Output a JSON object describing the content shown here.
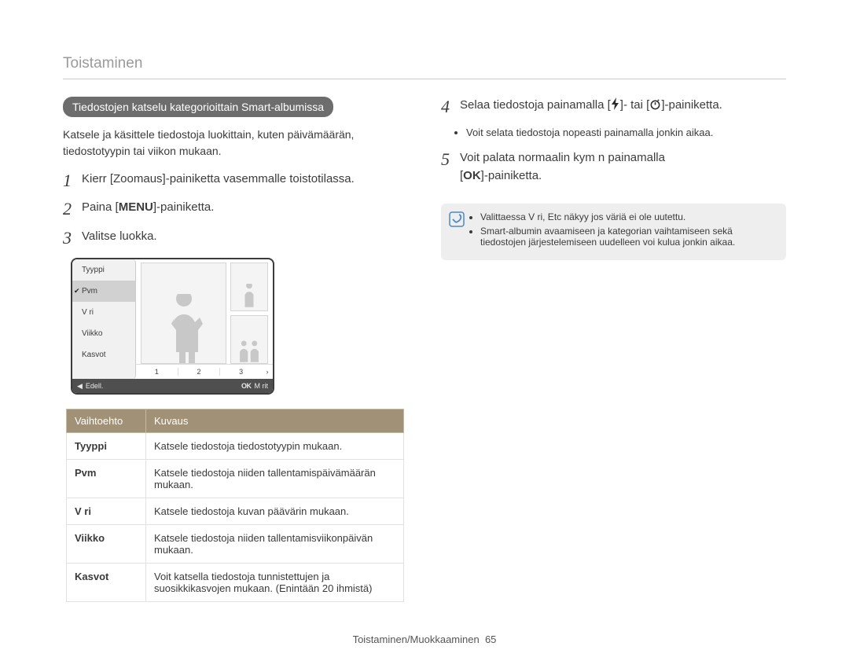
{
  "header": {
    "title": "Toistaminen"
  },
  "left": {
    "section_pill": "Tiedostojen katselu kategorioittain Smart-albumissa",
    "intro": "Katsele ja käsittele tiedostoja luokittain, kuten päivämäärän, tiedostotyypin tai viikon mukaan.",
    "steps": [
      {
        "num": "1",
        "prefix": "Kierr  [Zoomaus]-painiketta vasemmalle toistotilassa."
      },
      {
        "num": "2",
        "text_before": "Paina [",
        "label": "MENU",
        "text_after": "]-painiketta."
      },
      {
        "num": "3",
        "text": "Valitse luokka."
      }
    ],
    "camera": {
      "menu_items": [
        "Tyyppi",
        "Pvm",
        "V ri",
        "Viikko",
        "Kasvot"
      ],
      "selected_index": 1,
      "timeline": [
        "1",
        "2",
        "3"
      ],
      "footer_left_arrow": "◀",
      "footer_left_label": "Edell.",
      "footer_right_ok": "OK",
      "footer_right_label": "M rit"
    },
    "table": {
      "headers": [
        "Vaihtoehto",
        "Kuvaus"
      ],
      "rows": [
        [
          "Tyyppi",
          "Katsele tiedostoja tiedostotyypin mukaan."
        ],
        [
          "Pvm",
          "Katsele tiedostoja niiden tallentamispäivämäärän mukaan."
        ],
        [
          "V ri",
          "Katsele tiedostoja kuvan päävärin mukaan."
        ],
        [
          "Viikko",
          "Katsele tiedostoja niiden tallentamisviikonpäivän mukaan."
        ],
        [
          "Kasvot",
          "Voit katsella tiedostoja tunnistettujen ja suosikkikasvojen mukaan. (Enintään 20 ihmistä)"
        ]
      ]
    }
  },
  "right": {
    "step4": {
      "num": "4",
      "text_before": "Selaa tiedostoja painamalla [",
      "icon1": "flash-icon",
      "text_mid": "]- tai [",
      "icon2": "timer-icon",
      "text_after": "]-painiketta."
    },
    "step4_bullets": [
      "Voit selata tiedostoja nopeasti painamalla jonkin aikaa."
    ],
    "step5": {
      "num": "5",
      "line1": "Voit palata normaalin kym  n painamalla",
      "ok_label": "OK",
      "line2": "]-painiketta."
    },
    "note": {
      "items": [
        "Valittaessa V ri, Etc näkyy jos väriä ei ole uutettu.",
        "Smart-albumin avaamiseen ja kategorian vaihtamiseen sekä tiedostojen järjestelemiseen uudelleen voi kulua jonkin aikaa."
      ]
    }
  },
  "footer": {
    "section": "Toistaminen/Muokkaaminen",
    "page": "65"
  }
}
